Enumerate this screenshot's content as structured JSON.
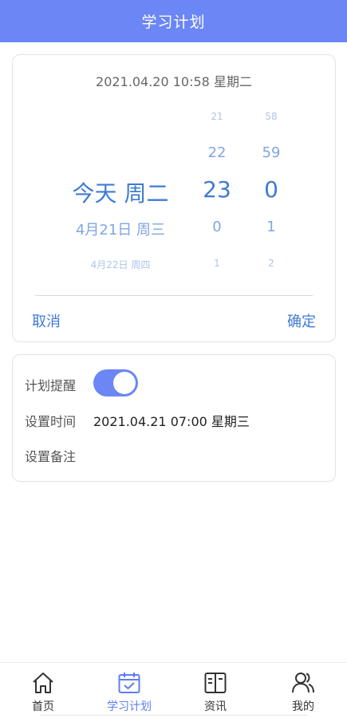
{
  "header": {
    "title": "学习计划"
  },
  "picker": {
    "current_datetime": "2021.04.20 10:58 星期二",
    "date_column": [
      "",
      "",
      "今天 周二",
      "4月21日 周三",
      "4月22日 周四"
    ],
    "hour_column": [
      "21",
      "22",
      "23",
      "0",
      "1"
    ],
    "minute_column": [
      "58",
      "59",
      "0",
      "1",
      "2"
    ],
    "cancel_label": "取消",
    "confirm_label": "确定"
  },
  "settings": {
    "reminder_label": "计划提醒",
    "reminder_on": true,
    "time_label": "设置时间",
    "time_value": "2021.04.21 07:00 星期三",
    "note_label": "设置备注",
    "note_value": ""
  },
  "tabbar": {
    "items": [
      {
        "label": "首页",
        "icon": "home-icon",
        "active": false
      },
      {
        "label": "学习计划",
        "icon": "calendar-check-icon",
        "active": true
      },
      {
        "label": "资讯",
        "icon": "book-icon",
        "active": false
      },
      {
        "label": "我的",
        "icon": "users-icon",
        "active": false
      }
    ]
  },
  "colors": {
    "accent": "#6b86f5",
    "picker_text": "#3f7bd4",
    "tab_active": "#5f7ef2"
  }
}
